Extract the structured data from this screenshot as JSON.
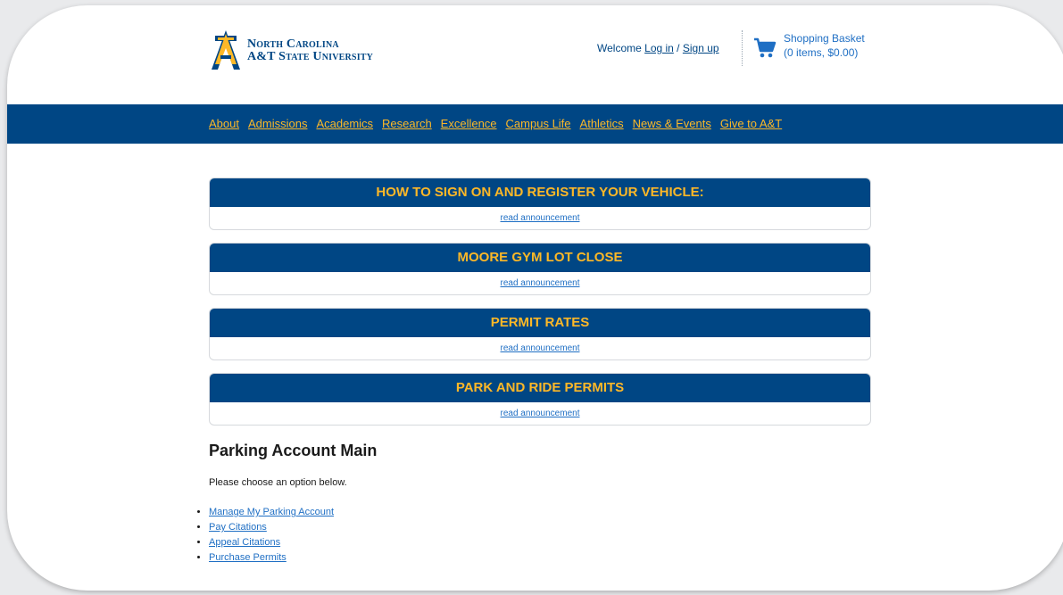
{
  "brand": {
    "line1": "North Carolina",
    "line2": "A&T State University",
    "navy": "#004684",
    "gold": "#fdb827"
  },
  "header": {
    "welcome_prefix": "Welcome ",
    "login_label": "Log in",
    "separator": " / ",
    "signup_label": "Sign up",
    "cart_title": "Shopping Basket",
    "cart_summary": "(0 items, $0.00)",
    "cart_icon": "shopping-cart-icon"
  },
  "nav": {
    "items": [
      "About",
      "Admissions",
      "Academics",
      "Research",
      "Excellence",
      "Campus Life",
      "Athletics",
      "News & Events",
      "Give to A&T"
    ]
  },
  "announcements": [
    {
      "title": "HOW TO SIGN ON AND REGISTER YOUR VEHICLE:",
      "link": "read announcement"
    },
    {
      "title": "MOORE GYM LOT CLOSE",
      "link": "read announcement"
    },
    {
      "title": "PERMIT RATES",
      "link": "read announcement"
    },
    {
      "title": "PARK AND RIDE PERMITS",
      "link": "read announcement"
    }
  ],
  "main": {
    "title": "Parking Account Main",
    "intro": "Please choose an option below.",
    "options": [
      "Manage My Parking Account",
      "Pay Citations",
      "Appeal Citations",
      "Purchase Permits"
    ]
  }
}
